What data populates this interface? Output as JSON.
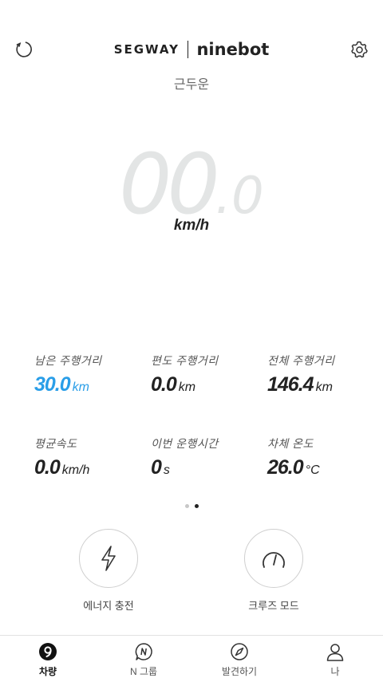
{
  "header": {
    "brand_left": "SEGWAY",
    "brand_right": "ninebot",
    "status": "근두운"
  },
  "speed": {
    "integer": "00",
    "decimal": ".0",
    "unit": "km/h"
  },
  "stats": [
    {
      "label": "남은 주행거리",
      "value": "30.0",
      "unit": "km"
    },
    {
      "label": "편도 주행거리",
      "value": "0.0",
      "unit": "km"
    },
    {
      "label": "전체 주행거리",
      "value": "146.4",
      "unit": "km"
    },
    {
      "label": "평균속도",
      "value": "0.0",
      "unit": "km/h"
    },
    {
      "label": "이번 운행시간",
      "value": "0",
      "unit": "s"
    },
    {
      "label": "차체 온도",
      "value": "26.0",
      "unit": "°C"
    }
  ],
  "pager": {
    "count": 2,
    "active": 2
  },
  "actions": {
    "energy": "에너지 충전",
    "cruise": "크루즈 모드"
  },
  "nav": [
    {
      "label": "차량"
    },
    {
      "label": "N 그룹"
    },
    {
      "label": "발견하기"
    },
    {
      "label": "나"
    }
  ],
  "colors": {
    "accent": "#2a9ee8",
    "speed_digits": "#e3e5e5"
  }
}
